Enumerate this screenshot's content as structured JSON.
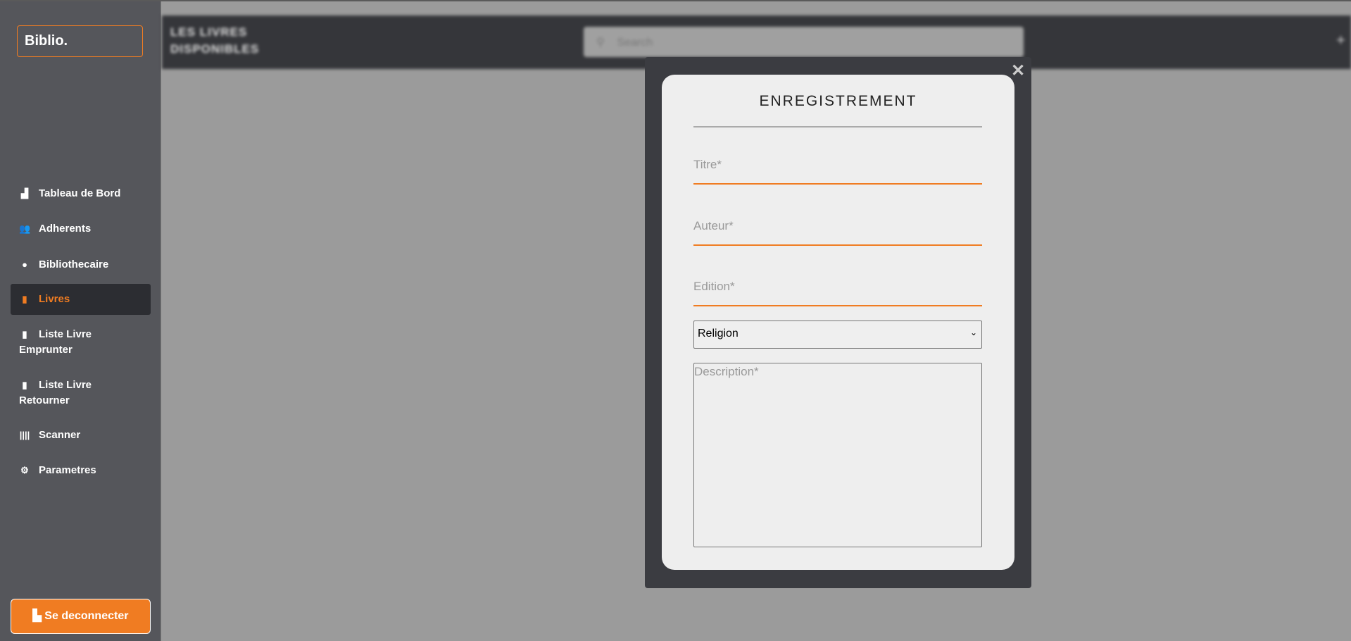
{
  "sidebar": {
    "logo": "Biblio.",
    "items": [
      {
        "label": "Tableau de Bord",
        "icon": "chart-icon"
      },
      {
        "label": "Adherents",
        "icon": "users-icon"
      },
      {
        "label": "Bibliothecaire",
        "icon": "user-icon"
      },
      {
        "label": "Livres",
        "icon": "book-icon",
        "active": true
      },
      {
        "label": "Liste Livre Emprunter",
        "icon": "book-icon"
      },
      {
        "label": "Liste Livre Retourner",
        "icon": "book-icon"
      },
      {
        "label": "Scanner",
        "icon": "barcode-icon"
      },
      {
        "label": "Parametres",
        "icon": "gear-icon"
      }
    ],
    "logout": "Se deconnecter"
  },
  "topbar": {
    "title": "LES LIVRES DISPONIBLES",
    "search_placeholder": "Search"
  },
  "modal": {
    "title": "ENREGISTREMENT",
    "titre_placeholder": "Titre*",
    "auteur_placeholder": "Auteur*",
    "edition_placeholder": "Edition*",
    "category_selected": "Religion",
    "description_placeholder": "Description*"
  },
  "colors": {
    "accent": "#f07c22",
    "sidebar": "#55565b",
    "overlay": "#9b9b9b"
  }
}
